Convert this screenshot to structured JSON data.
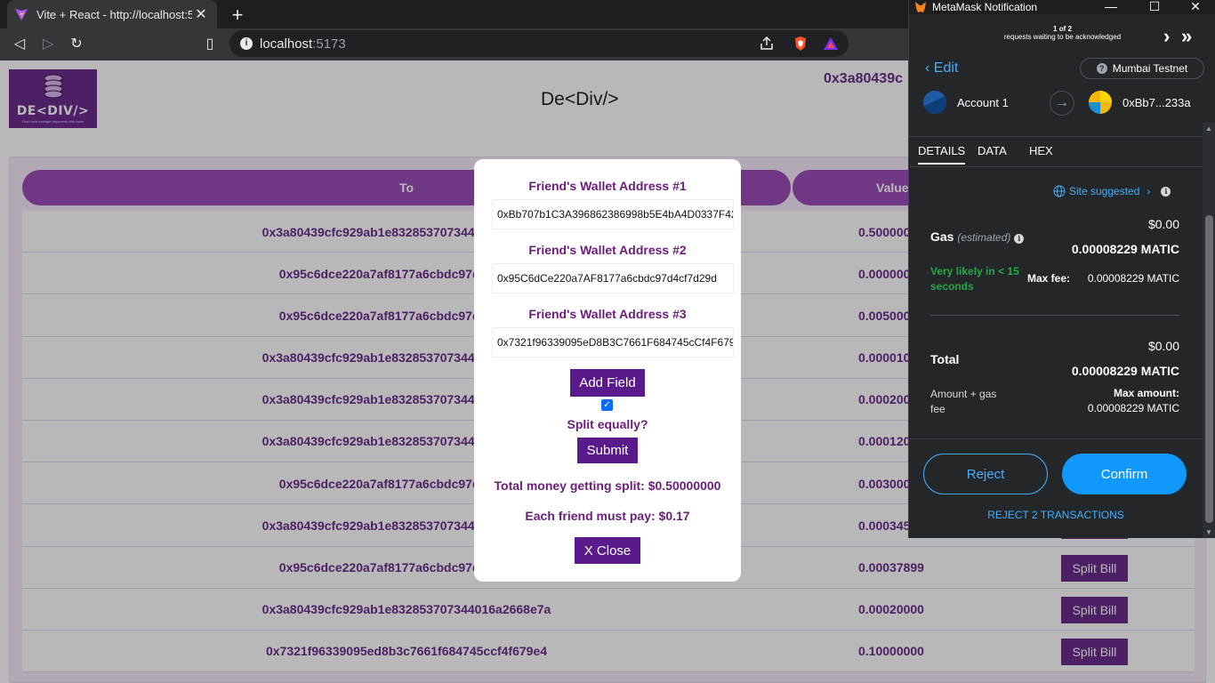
{
  "browser": {
    "tab_title": "Vite + React - http://localhost:517",
    "url_host": "localhost",
    "url_port": ":5173"
  },
  "page": {
    "brand": "De<Div/>",
    "account_address": "0x3a80439c",
    "logo_text": "DE<DIV/>",
    "logo_tagline": "Don't and manage payments with ease",
    "table": {
      "col_to": "To",
      "col_value": "Value",
      "rows": [
        {
          "to": "0x3a80439cfc929ab1e832853707344016a2668e7a",
          "value": "0.50000000"
        },
        {
          "to": "0x95c6dce220a7af8177a6cbdc97d4cf7d29d",
          "value": "0.00000000"
        },
        {
          "to": "0x95c6dce220a7af8177a6cbdc97d4cf7d29d",
          "value": "0.00500000"
        },
        {
          "to": "0x3a80439cfc929ab1e832853707344016a2668e7a",
          "value": "0.00001000"
        },
        {
          "to": "0x3a80439cfc929ab1e832853707344016a2668e7a",
          "value": "0.00020000"
        },
        {
          "to": "0x3a80439cfc929ab1e832853707344016a2668e7a",
          "value": "0.00012000"
        },
        {
          "to": "0x95c6dce220a7af8177a6cbdc97d4cf7d29d",
          "value": "0.00300000"
        },
        {
          "to": "0x3a80439cfc929ab1e832853707344016a2668e7a",
          "value": "0.00034500"
        },
        {
          "to": "0x95c6dce220a7af8177a6cbdc97d4cf7d29d",
          "value": "0.00037899"
        },
        {
          "to": "0x3a80439cfc929ab1e832853707344016a2668e7a",
          "value": "0.00020000"
        },
        {
          "to": "0x7321f96339095ed8b3c7661f684745ccf4f679e4",
          "value": "0.10000000"
        }
      ],
      "split_label": "Split Bill"
    }
  },
  "modal": {
    "label1": "Friend's Wallet Address #1",
    "value1": "0xBb707b1C3A396862386998b5E4bA4D0337F4233a",
    "label2": "Friend's Wallet Address #2",
    "value2": "0x95C6dCe220a7AF8177a6cbdc97d4cf7d29d",
    "label3": "Friend's Wallet Address #3",
    "value3": "0x7321f96339095eD8B3C7661F684745cCf4F679E4",
    "add_field": "Add Field",
    "split_equally": "Split equally?",
    "submit": "Submit",
    "total": "Total money getting split: $0.50000000",
    "each": "Each friend must pay: $0.17",
    "close": "X Close"
  },
  "metamask": {
    "window_title": "MetaMask Notification",
    "count": "1 of 2",
    "count_sub": "requests waiting to be acknowledged",
    "edit": "Edit",
    "network": "Mumbai Testnet",
    "from": "Account 1",
    "to": "0xBb7...233a",
    "tabs": [
      "DETAILS",
      "DATA",
      "HEX"
    ],
    "site_suggested": "Site suggested",
    "gas_label": "Gas",
    "gas_est": "(estimated)",
    "gas_usd": "$0.00",
    "gas_matic": "0.00008229 MATIC",
    "likely": "Very likely in < 15 seconds",
    "max_fee_label": "Max fee:",
    "max_fee": "0.00008229 MATIC",
    "total_label": "Total",
    "total_usd": "$0.00",
    "total_matic": "0.00008229 MATIC",
    "amount_gas": "Amount + gas fee",
    "max_amount_label": "Max amount:",
    "max_amount": "0.00008229 MATIC",
    "reject": "Reject",
    "confirm": "Confirm",
    "reject_all": "REJECT 2 TRANSACTIONS"
  }
}
